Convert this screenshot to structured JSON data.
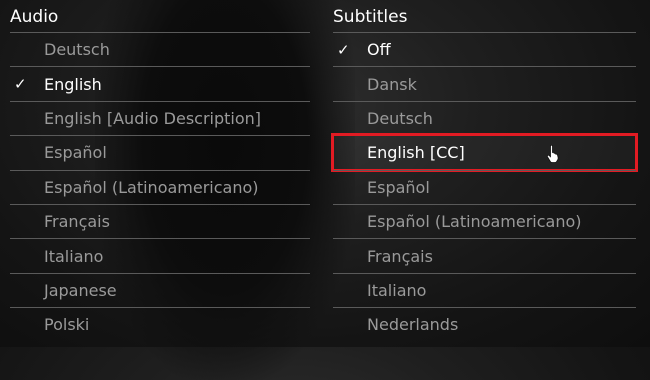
{
  "audio": {
    "header": "Audio",
    "items": [
      {
        "label": "Deutsch"
      },
      {
        "label": "English",
        "selected": true
      },
      {
        "label": "English [Audio Description]"
      },
      {
        "label": "Español"
      },
      {
        "label": "Español (Latinoamericano)"
      },
      {
        "label": "Français"
      },
      {
        "label": "Italiano"
      },
      {
        "label": "Japanese"
      },
      {
        "label": "Polski"
      }
    ]
  },
  "subtitles": {
    "header": "Subtitles",
    "items": [
      {
        "label": "Off",
        "selected": true
      },
      {
        "label": "Dansk"
      },
      {
        "label": "Deutsch"
      },
      {
        "label": "English [CC]",
        "highlighted": true
      },
      {
        "label": "Español"
      },
      {
        "label": "Español (Latinoamericano)"
      },
      {
        "label": "Français"
      },
      {
        "label": "Italiano"
      },
      {
        "label": "Nederlands"
      }
    ]
  },
  "icons": {
    "check": "✓",
    "cursor": "hand-pointer-icon"
  },
  "colors": {
    "highlight_border": "#e21b23",
    "selected_text": "#ffffff",
    "unselected_text": "#9a9a9a"
  }
}
